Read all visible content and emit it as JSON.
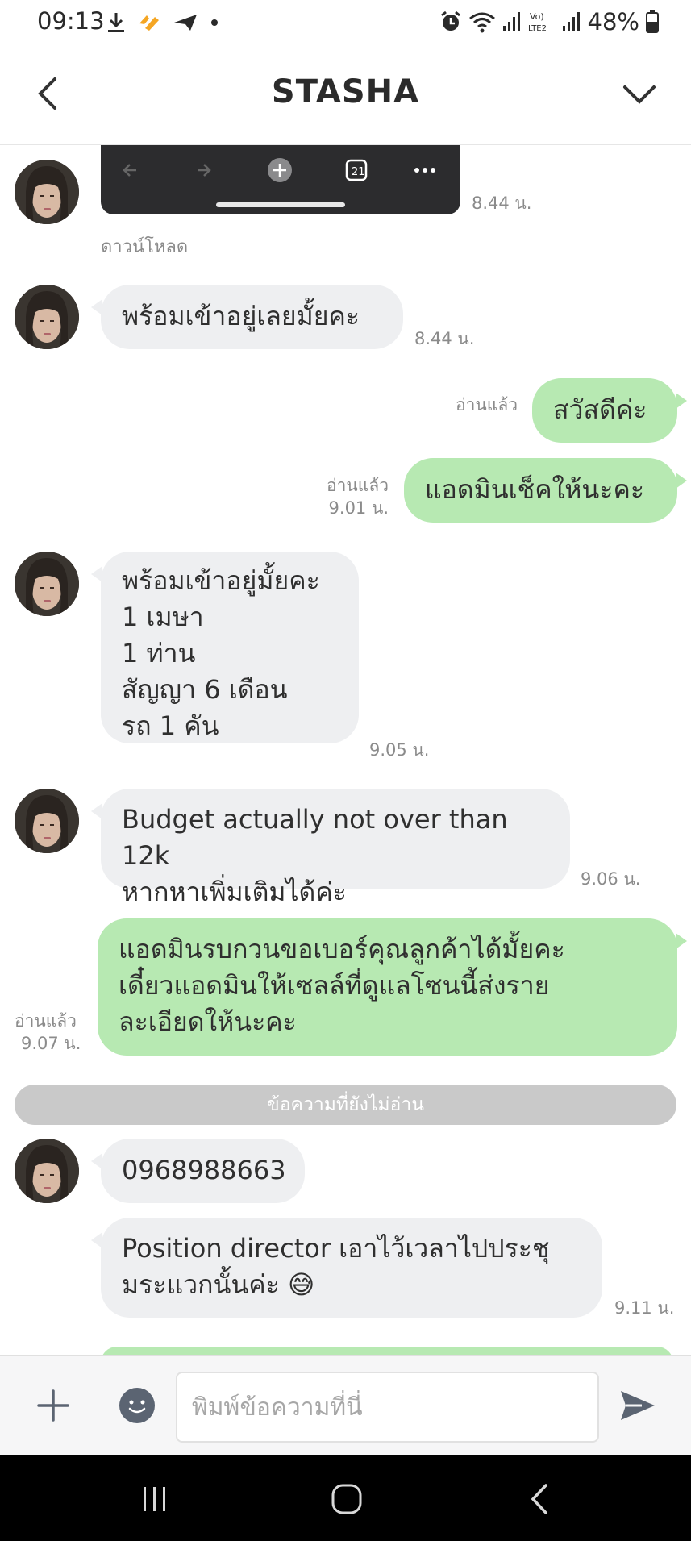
{
  "status_bar": {
    "time": "09:13",
    "battery": "48%",
    "icons": [
      "download-icon",
      "app-icon",
      "send-icon",
      "dot-icon",
      "alarm-icon",
      "wifi-icon",
      "signal-icon",
      "volte-icon",
      "signal-icon",
      "battery-icon"
    ]
  },
  "header": {
    "title": "STASHA",
    "back_icon": "chevron-left-icon",
    "menu_icon": "chevron-down-icon"
  },
  "messages": {
    "m1": {
      "download_label": "ดาวน์โหลด",
      "time": "8.44 น."
    },
    "m2": {
      "text": "พร้อมเข้าอยู่เลยมั้ยคะ",
      "time": "8.44 น."
    },
    "m3": {
      "text": "สวัสดีค่ะ",
      "read": "อ่านแล้ว"
    },
    "m4": {
      "text": "แอดมินเช็คให้นะคะ",
      "read": "อ่านแล้ว",
      "time": "9.01 น."
    },
    "m5": {
      "lines": [
        "พร้อมเข้าอยู่มั้ยคะ",
        "1 เมษา",
        "1 ท่าน",
        "สัญญา 6 เดือน",
        "รถ 1 คัน"
      ],
      "time": "9.05 น."
    },
    "m6": {
      "lines": [
        "Budget actually not over than 12k",
        "หากหาเพิ่มเติมได้ค่ะ"
      ],
      "time": "9.06 น."
    },
    "m7": {
      "lines": [
        "แอดมินรบกวนขอเบอร์คุณลูกค้าได้มั้ยคะ",
        "เดี๋ยวแอดมินให้เซลล์ที่ดูแลโซนนี้ส่งราย",
        "ละเอียดให้นะคะ"
      ],
      "read": "อ่านแล้ว",
      "time": "9.07 น."
    },
    "unread_divider": "ข้อความที่ยังไม่อ่าน",
    "m8": {
      "text": "0968988663"
    },
    "m9": {
      "lines": [
        "Position director เอาไว้เวลาไปประชุ",
        "มระแวกนั้นค่ะ 😅"
      ],
      "time": "9.11 น."
    }
  },
  "input_bar": {
    "placeholder": "พิมพ์ข้อความที่นี่",
    "value": ""
  },
  "colors": {
    "incoming_bubble": "#eeeff1",
    "outgoing_bubble": "#b7e9b2",
    "divider": "#c9c9c9",
    "nav_bar": "#000000"
  }
}
